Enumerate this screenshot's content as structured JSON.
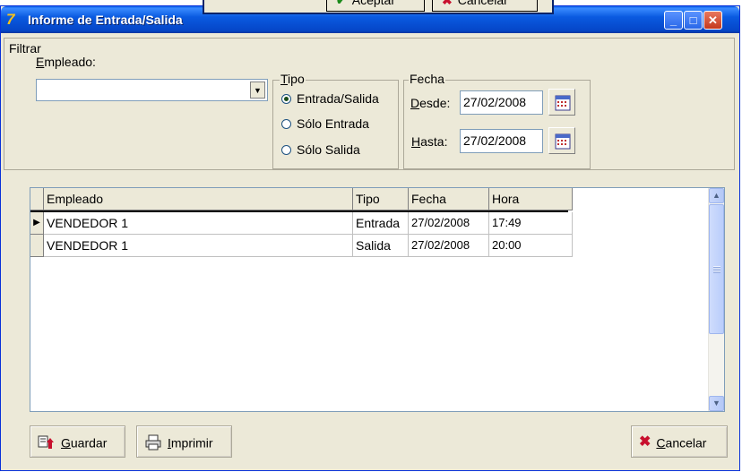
{
  "window": {
    "title": "Informe de Entrada/Salida"
  },
  "overlay": {
    "accept_label": "Aceptar",
    "cancel_label": "Cancelar"
  },
  "filter": {
    "legend": "Filtrar",
    "employee_label": "Empleado:",
    "employee_value": "",
    "tipo": {
      "legend": "Tipo",
      "options": [
        {
          "label": "Entrada/Salida",
          "selected": true
        },
        {
          "label": "Sólo Entrada",
          "selected": false
        },
        {
          "label": "Sólo Salida",
          "selected": false
        }
      ]
    },
    "fecha": {
      "legend": "Fecha",
      "desde_label": "Desde:",
      "desde_value": "27/02/2008",
      "hasta_label": "Hasta:",
      "hasta_value": "27/02/2008"
    }
  },
  "grid": {
    "columns": [
      "Empleado",
      "Tipo",
      "Fecha",
      "Hora"
    ],
    "rows": [
      {
        "empleado": "VENDEDOR 1",
        "tipo": "Entrada",
        "fecha": "27/02/2008",
        "hora": "17:49",
        "current": true
      },
      {
        "empleado": "VENDEDOR 1",
        "tipo": "Salida",
        "fecha": "27/02/2008",
        "hora": "20:00",
        "current": false
      }
    ]
  },
  "buttons": {
    "guardar": "Guardar",
    "imprimir": "Imprimir",
    "cancelar": "Cancelar"
  }
}
